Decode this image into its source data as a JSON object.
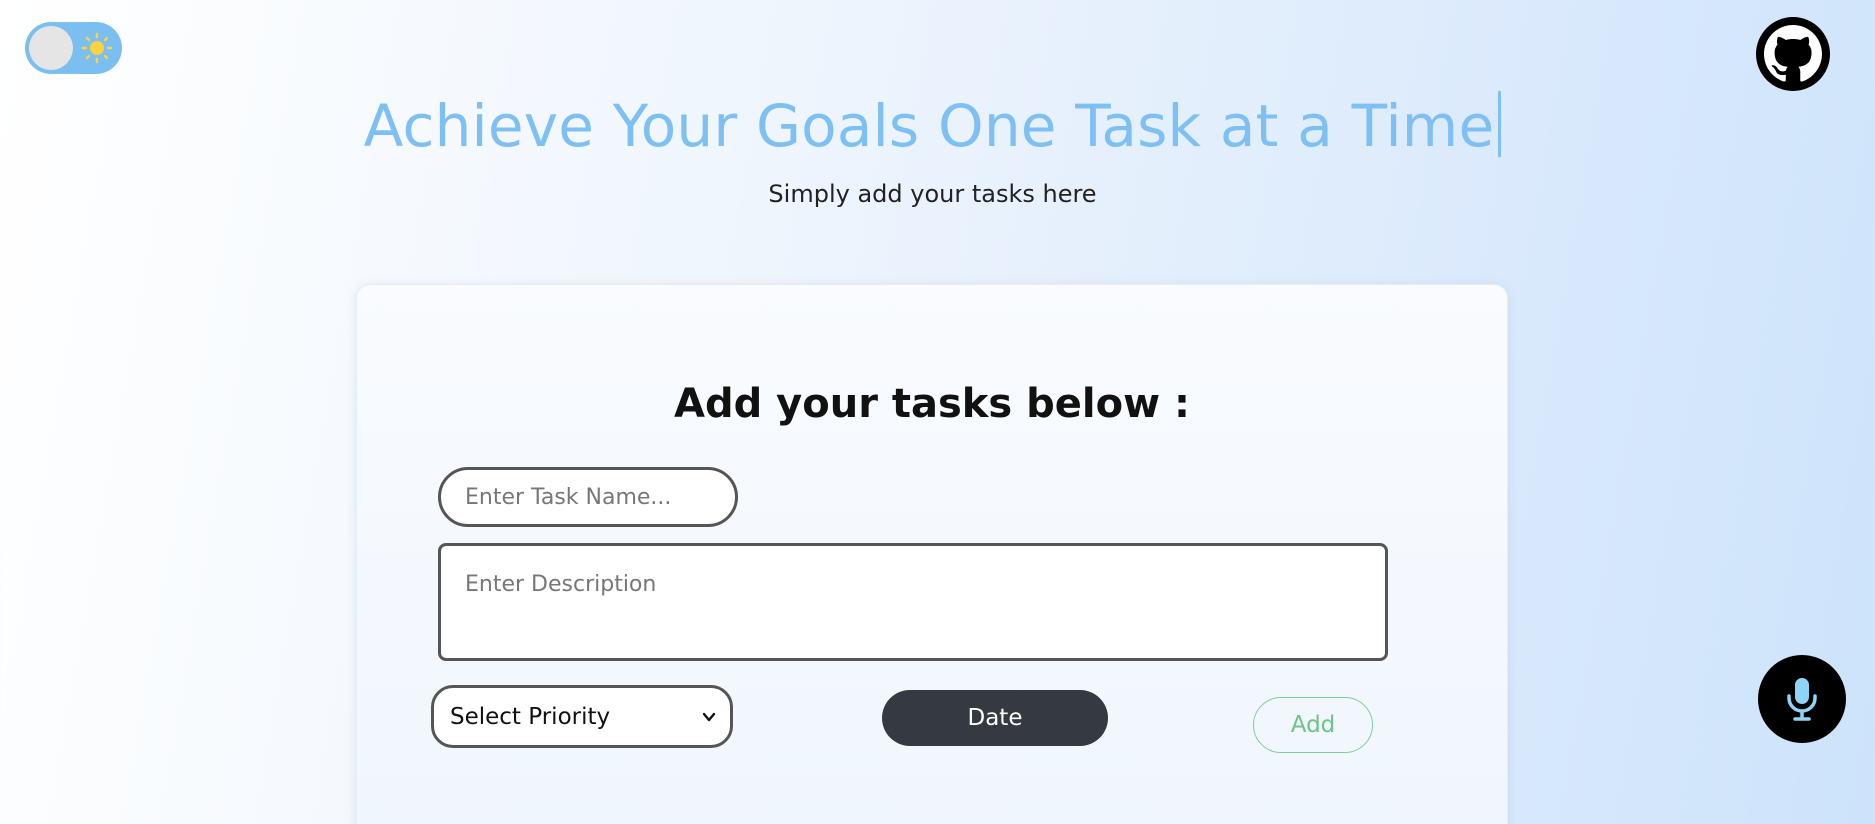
{
  "header": {
    "title": "Achieve Your Goals One Task at a Time",
    "subtitle": "Simply add your tasks here"
  },
  "theme_toggle": {
    "icon": "sun-icon",
    "state": "light"
  },
  "github": {
    "icon": "github-icon"
  },
  "form": {
    "heading": "Add your tasks below :",
    "task_name_placeholder": "Enter Task Name...",
    "description_placeholder": "Enter Description",
    "priority_selected": "Select Priority",
    "date_label": "Date",
    "add_label": "Add"
  },
  "voice": {
    "icon": "microphone-icon"
  },
  "colors": {
    "accent": "#7ec0f3",
    "date_button": "#353a42",
    "add_button": "#6cc487"
  }
}
